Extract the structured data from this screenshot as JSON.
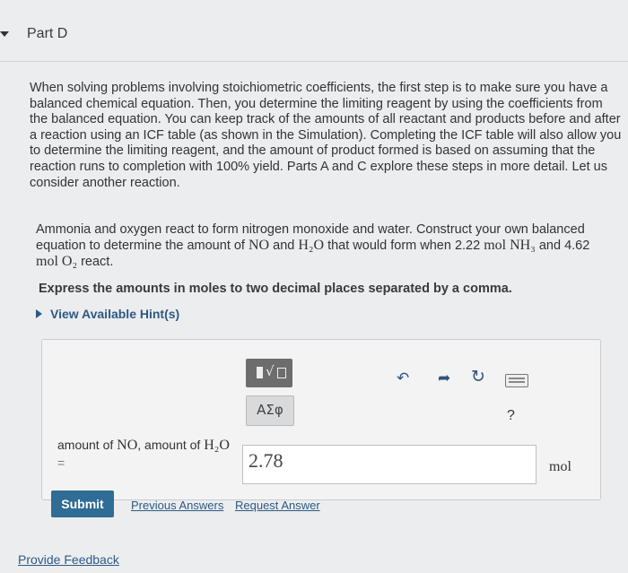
{
  "part": {
    "title": "Part D"
  },
  "intro": {
    "text": "When solving problems involving stoichiometric coefficients, the first step is to make sure you have a balanced chemical equation. Then, you determine the limiting reagent by using the coefficients from the balanced equation. You can keep track of the amounts of all reactant and products before and after a reaction using an ICF table (as shown in the Simulation). Completing the ICF table will also allow you to determine the limiting reagent, and the amount of product formed is based on assuming that the reaction runs to completion with 100% yield. Parts A and C explore these steps in more detail. Let us consider another reaction."
  },
  "question": {
    "s1": "Ammonia and oxygen react to form nitrogen monoxide and water. Construct your own balanced equation to determine the amount of",
    "no": "NO",
    "and1": "and",
    "h2o": "H₂O",
    "s2": "that would form when 2.22",
    "mol1": "mol",
    "nh3": "NH₃",
    "and2": "and",
    "amount2": "4.62",
    "mol2": "mol",
    "o2": "O₂",
    "s3": "react."
  },
  "instruction": "Express the amounts in moles to two decimal places separated by a comma.",
  "hints": {
    "label": "View Available Hint(s)"
  },
  "toolbar": {
    "math_icon": "templates-icon",
    "greek_label": "ΑΣφ",
    "undo_icon": "undo-icon",
    "redo_icon": "redo-icon",
    "reset_icon": "reset-icon",
    "keyboard_icon": "keyboard-icon",
    "help_label": "?"
  },
  "answer": {
    "label_prefix": "amount of",
    "label_no": "NO",
    "label_mid": ", amount of",
    "label_h2o": "H₂O",
    "equals": "=",
    "value": "2.78",
    "unit": "mol"
  },
  "actions": {
    "submit": "Submit",
    "previous_answers": "Previous Answers",
    "request_answer": "Request Answer"
  },
  "footer": {
    "feedback": "Provide Feedback"
  },
  "colors": {
    "link": "#2c5a85",
    "submit_bg": "#2f6c96",
    "math_btn": "#6d6d6d"
  }
}
